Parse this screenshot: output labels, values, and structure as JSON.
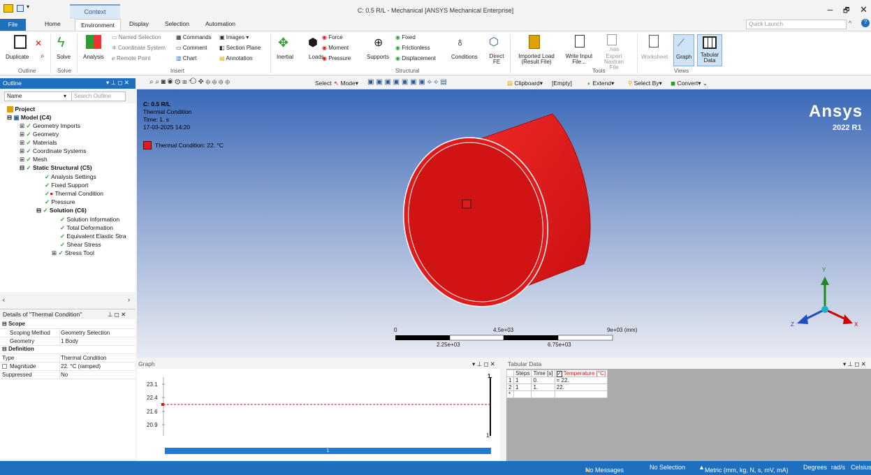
{
  "window": {
    "title": "C: 0.5 R/L - Mechanical [ANSYS Mechanical Enterprise]",
    "context_tab": "Context",
    "controls": [
      "–",
      "🗗",
      "✕"
    ]
  },
  "tabs": {
    "file": "File",
    "items": [
      "Home",
      "Environment",
      "Display",
      "Selection",
      "Automation"
    ],
    "active": "Environment"
  },
  "quick_launch": {
    "placeholder": "Quick Launch"
  },
  "ribbon": {
    "outline_group": {
      "label": "Outline",
      "duplicate": "Duplicate"
    },
    "solve_group": {
      "label": "Solve",
      "solve": "Solve"
    },
    "insert_group": {
      "label": "Insert",
      "analysis": "Analysis",
      "named_selection": "Named Selection",
      "coordinate_system": "Coordinate System",
      "remote_point": "Remote Point",
      "commands": "Commands",
      "comment": "Comment",
      "chart": "Chart",
      "images": "Images",
      "section_plane": "Section Plane",
      "annotation": "Annotation"
    },
    "structural_group": {
      "label": "Structural",
      "inertial": "Inertial",
      "loads": "Loads",
      "force": "Force",
      "moment": "Moment",
      "pressure": "Pressure",
      "supports": "Supports",
      "fixed": "Fixed",
      "frictionless": "Frictionless",
      "displacement": "Displacement",
      "conditions": "Conditions",
      "direct_fe": "Direct FE"
    },
    "tools_group": {
      "label": "Tools",
      "imported_load": "Imported Load (Result File)",
      "write_input": "Write Input File...",
      "export_nastran": "Export Nastran File",
      "nas": ".nas"
    },
    "views_group": {
      "label": "Views",
      "worksheet": "Worksheet",
      "graph": "Graph",
      "tabular": "Tabular Data"
    }
  },
  "toolbar": {
    "select": "Select",
    "mode": "Mode",
    "clipboard": "Clipboard",
    "empty": "[Empty]",
    "extend": "Extend",
    "select_by": "Select By",
    "convert": "Convert"
  },
  "outline": {
    "title": "Outline",
    "filter_name": "Name",
    "search_placeholder": "Search Outline",
    "tree": [
      {
        "label": "Project",
        "bold": true
      },
      {
        "label": "Model (C4)",
        "bold": true
      },
      {
        "label": "Geometry Imports"
      },
      {
        "label": "Geometry"
      },
      {
        "label": "Materials"
      },
      {
        "label": "Coordinate Systems"
      },
      {
        "label": "Mesh"
      },
      {
        "label": "Static Structural (C5)",
        "bold": true
      },
      {
        "label": "Analysis Settings"
      },
      {
        "label": "Fixed Support"
      },
      {
        "label": "Thermal Condition",
        "selected": true
      },
      {
        "label": "Pressure"
      },
      {
        "label": "Solution (C6)",
        "bold": true
      },
      {
        "label": "Solution Information"
      },
      {
        "label": "Total Deformation"
      },
      {
        "label": "Equivalent Elastic Stra"
      },
      {
        "label": "Shear Stress"
      },
      {
        "label": "Stress Tool"
      }
    ]
  },
  "details": {
    "title": "Details of \"Thermal Condition\"",
    "scope_label": "Scope",
    "scoping_method": {
      "key": "Scoping Method",
      "value": "Geometry Selection"
    },
    "geometry": {
      "key": "Geometry",
      "value": "1 Body"
    },
    "definition_label": "Definition",
    "type": {
      "key": "Type",
      "value": "Thermal Condition"
    },
    "magnitude": {
      "key": "Magnitude",
      "value": "22. °C  (ramped)"
    },
    "suppressed": {
      "key": "Suppressed",
      "value": "No"
    }
  },
  "viewport": {
    "model_name": "C: 0.5 R/L",
    "object": "Thermal Condition",
    "time": "Time: 1. s",
    "date": "17-03-2025 14:20",
    "legend": "Thermal Condition: 22. °C",
    "brand": "Ansys",
    "version": "2022 R1",
    "scale": {
      "t0": "0",
      "t1": "4.5e+03",
      "t2": "9e+03 (mm)",
      "b1": "2.25e+03",
      "b2": "6.75e+03"
    },
    "axes": {
      "x": "X",
      "y": "Y",
      "z": "Z"
    },
    "colors": {
      "body": "#e11b1b",
      "accent": "#1f6fbf"
    }
  },
  "graph": {
    "title": "Graph",
    "yticks": [
      "23.1",
      "22.4",
      "21.6",
      "20.9"
    ],
    "top_label": "1.",
    "right_label": "1.",
    "bar_label": "1"
  },
  "tabular": {
    "title": "Tabular Data",
    "headers": [
      "Steps",
      "Time [s]",
      "Temperature [°C]"
    ],
    "rows": [
      {
        "idx": "1",
        "steps": "1",
        "time": "0.",
        "temp": "= 22."
      },
      {
        "idx": "2",
        "steps": "1",
        "time": "1.",
        "temp": "22."
      },
      {
        "idx": "*",
        "steps": "",
        "time": "",
        "temp": ""
      }
    ]
  },
  "status": {
    "messages": "No Messages",
    "selection": "No Selection",
    "units": "Metric (mm, kg, N, s, mV, mA)",
    "angle": "Degrees",
    "rate": "rad/s",
    "temp": "Celsius"
  }
}
